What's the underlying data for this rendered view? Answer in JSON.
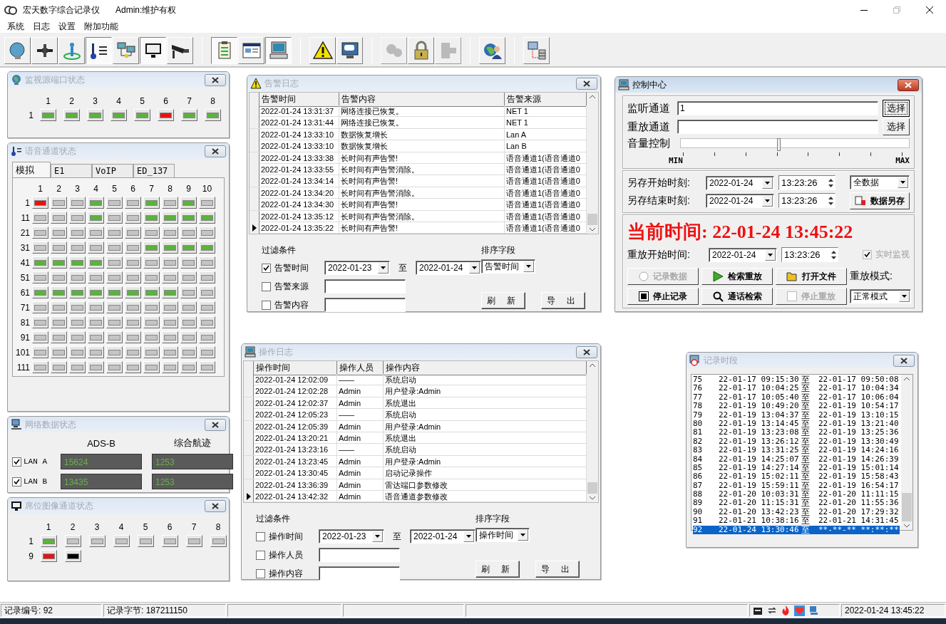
{
  "app": {
    "title": "宏天数字综合记录仪",
    "user": "Admin:维护有权"
  },
  "menu": [
    {
      "label": "系统"
    },
    {
      "label": "日志"
    },
    {
      "label": "设置"
    },
    {
      "label": "附加功能"
    }
  ],
  "toolbar": [
    [
      {
        "pressed": false,
        "disabled": false
      },
      {
        "pressed": false,
        "disabled": false
      },
      {
        "pressed": false,
        "disabled": false
      },
      {
        "pressed": true,
        "disabled": false
      },
      {
        "pressed": false,
        "disabled": false
      },
      {
        "pressed": true,
        "disabled": false
      },
      {
        "pressed": false,
        "disabled": false
      }
    ],
    [
      {
        "pressed": true,
        "disabled": false
      },
      {
        "pressed": false,
        "disabled": false
      },
      {
        "pressed": true,
        "disabled": false
      }
    ],
    [
      {
        "pressed": false,
        "disabled": false
      },
      {
        "pressed": false,
        "disabled": false
      }
    ],
    [
      {
        "pressed": false,
        "disabled": true
      },
      {
        "pressed": false,
        "disabled": false
      },
      {
        "pressed": false,
        "disabled": true
      }
    ],
    [
      {
        "pressed": false,
        "disabled": false
      }
    ],
    [
      {
        "pressed": false,
        "disabled": false
      }
    ]
  ],
  "port_status": {
    "title": "监视源端口状态",
    "active": false,
    "columns": [
      "1",
      "2",
      "3",
      "4",
      "5",
      "6",
      "7",
      "8"
    ],
    "rows": [
      {
        "label": "1",
        "lights": [
          {
            "color": "#5ab33b"
          },
          {
            "color": "#5ab33b"
          },
          {
            "color": "#5ab33b"
          },
          {
            "color": "#5ab33b"
          },
          {
            "color": "#5ab33b"
          },
          {
            "color": "#e31414"
          },
          {
            "color": "#5ab33b"
          },
          {
            "color": "#5ab33b"
          }
        ]
      }
    ]
  },
  "voice_status": {
    "title": "语音通道状态",
    "active": false,
    "tabs": [
      {
        "label": "模拟",
        "selected": true
      },
      {
        "label": "E1",
        "selected": false
      },
      {
        "label": "VoIP",
        "selected": false
      },
      {
        "label": "ED_137",
        "selected": false
      }
    ],
    "columns": [
      "1",
      "2",
      "3",
      "4",
      "5",
      "6",
      "7",
      "8",
      "9",
      "10"
    ],
    "rows": [
      {
        "label": "1",
        "lights": [
          {
            "color": "#e31414"
          },
          {
            "color": "#c4c4c4"
          },
          {
            "color": "#c4c4c4"
          },
          {
            "color": "#5ab33b"
          },
          {
            "color": "#c4c4c4"
          },
          {
            "color": "#c4c4c4"
          },
          {
            "color": "#5ab33b"
          },
          {
            "color": "#c4c4c4"
          },
          {
            "color": "#5ab33b"
          },
          {
            "color": "#c4c4c4"
          }
        ]
      },
      {
        "label": "11",
        "lights": [
          {
            "color": "#c4c4c4"
          },
          {
            "color": "#c4c4c4"
          },
          {
            "color": "#c4c4c4"
          },
          {
            "color": "#5ab33b"
          },
          {
            "color": "#c4c4c4"
          },
          {
            "color": "#c4c4c4"
          },
          {
            "color": "#5ab33b"
          },
          {
            "color": "#5ab33b"
          },
          {
            "color": "#5ab33b"
          },
          {
            "color": "#5ab33b"
          }
        ]
      },
      {
        "label": "21",
        "lights": [
          {
            "color": "#c4c4c4"
          },
          {
            "color": "#c4c4c4"
          },
          {
            "color": "#c4c4c4"
          },
          {
            "color": "#c4c4c4"
          },
          {
            "color": "#c4c4c4"
          },
          {
            "color": "#c4c4c4"
          },
          {
            "color": "#c4c4c4"
          },
          {
            "color": "#c4c4c4"
          },
          {
            "color": "#c4c4c4"
          },
          {
            "color": "#c4c4c4"
          }
        ]
      },
      {
        "label": "31",
        "lights": [
          {
            "color": "#c4c4c4"
          },
          {
            "color": "#c4c4c4"
          },
          {
            "color": "#c4c4c4"
          },
          {
            "color": "#c4c4c4"
          },
          {
            "color": "#c4c4c4"
          },
          {
            "color": "#c4c4c4"
          },
          {
            "color": "#5ab33b"
          },
          {
            "color": "#5ab33b"
          },
          {
            "color": "#5ab33b"
          },
          {
            "color": "#5ab33b"
          }
        ]
      },
      {
        "label": "41",
        "lights": [
          {
            "color": "#5ab33b"
          },
          {
            "color": "#5ab33b"
          },
          {
            "color": "#5ab33b"
          },
          {
            "color": "#5ab33b"
          },
          {
            "color": "#c4c4c4"
          },
          {
            "color": "#c4c4c4"
          },
          {
            "color": "#c4c4c4"
          },
          {
            "color": "#c4c4c4"
          },
          {
            "color": "#c4c4c4"
          },
          {
            "color": "#c4c4c4"
          }
        ]
      },
      {
        "label": "51",
        "lights": [
          {
            "color": "#c4c4c4"
          },
          {
            "color": "#c4c4c4"
          },
          {
            "color": "#c4c4c4"
          },
          {
            "color": "#c4c4c4"
          },
          {
            "color": "#c4c4c4"
          },
          {
            "color": "#c4c4c4"
          },
          {
            "color": "#c4c4c4"
          },
          {
            "color": "#c4c4c4"
          },
          {
            "color": "#c4c4c4"
          },
          {
            "color": "#c4c4c4"
          }
        ]
      },
      {
        "label": "61",
        "lights": [
          {
            "color": "#5ab33b"
          },
          {
            "color": "#5ab33b"
          },
          {
            "color": "#5ab33b"
          },
          {
            "color": "#5ab33b"
          },
          {
            "color": "#5ab33b"
          },
          {
            "color": "#5ab33b"
          },
          {
            "color": "#5ab33b"
          },
          {
            "color": "#5ab33b"
          },
          {
            "color": "#c4c4c4"
          },
          {
            "color": "#c4c4c4"
          }
        ]
      },
      {
        "label": "71",
        "lights": [
          {
            "color": "#c4c4c4"
          },
          {
            "color": "#c4c4c4"
          },
          {
            "color": "#c4c4c4"
          },
          {
            "color": "#c4c4c4"
          },
          {
            "color": "#c4c4c4"
          },
          {
            "color": "#c4c4c4"
          },
          {
            "color": "#c4c4c4"
          },
          {
            "color": "#c4c4c4"
          },
          {
            "color": "#c4c4c4"
          },
          {
            "color": "#c4c4c4"
          }
        ]
      },
      {
        "label": "81",
        "lights": [
          {
            "color": "#c4c4c4"
          },
          {
            "color": "#c4c4c4"
          },
          {
            "color": "#c4c4c4"
          },
          {
            "color": "#c4c4c4"
          },
          {
            "color": "#c4c4c4"
          },
          {
            "color": "#c4c4c4"
          },
          {
            "color": "#c4c4c4"
          },
          {
            "color": "#c4c4c4"
          },
          {
            "color": "#c4c4c4"
          },
          {
            "color": "#c4c4c4"
          }
        ]
      },
      {
        "label": "91",
        "lights": [
          {
            "color": "#c4c4c4"
          },
          {
            "color": "#c4c4c4"
          },
          {
            "color": "#c4c4c4"
          },
          {
            "color": "#c4c4c4"
          },
          {
            "color": "#c4c4c4"
          },
          {
            "color": "#c4c4c4"
          },
          {
            "color": "#c4c4c4"
          },
          {
            "color": "#c4c4c4"
          },
          {
            "color": "#c4c4c4"
          },
          {
            "color": "#c4c4c4"
          }
        ]
      },
      {
        "label": "101",
        "lights": [
          {
            "color": "#c4c4c4"
          },
          {
            "color": "#c4c4c4"
          },
          {
            "color": "#c4c4c4"
          },
          {
            "color": "#c4c4c4"
          },
          {
            "color": "#c4c4c4"
          },
          {
            "color": "#c4c4c4"
          },
          {
            "color": "#c4c4c4"
          },
          {
            "color": "#c4c4c4"
          },
          {
            "color": "#c4c4c4"
          },
          {
            "color": "#c4c4c4"
          }
        ]
      },
      {
        "label": "111",
        "lights": [
          {
            "color": "#c4c4c4"
          },
          {
            "color": "#c4c4c4"
          },
          {
            "color": "#c4c4c4"
          },
          {
            "color": "#c4c4c4"
          },
          {
            "color": "#c4c4c4"
          },
          {
            "color": "#c4c4c4"
          },
          {
            "color": "#c4c4c4"
          },
          {
            "color": "#c4c4c4"
          },
          {
            "color": "#c4c4c4"
          },
          {
            "color": "#c4c4c4"
          }
        ]
      }
    ]
  },
  "network_status": {
    "title": "网络数据状态",
    "active": false,
    "columns": [
      "ADS-B",
      "综合航迹"
    ],
    "rows": [
      {
        "label": "LAN A",
        "checked": true,
        "values": [
          "15624",
          "1253"
        ]
      },
      {
        "label": "LAN B",
        "checked": true,
        "values": [
          "13435",
          "1253"
        ]
      }
    ]
  },
  "seat_status": {
    "title": "席位图像通道状态",
    "active": false,
    "columns": [
      "1",
      "2",
      "3",
      "4",
      "5",
      "6",
      "7",
      "8"
    ],
    "rows": [
      {
        "label": "1",
        "lights": [
          {
            "color": "#5ab33b"
          },
          {
            "color": "#c4c4c4"
          },
          {
            "color": "#c4c4c4"
          },
          {
            "color": "#c4c4c4"
          },
          {
            "color": "#c4c4c4"
          },
          {
            "color": "#c4c4c4"
          },
          {
            "color": "#c4c4c4"
          },
          {
            "color": "#c4c4c4"
          }
        ]
      },
      {
        "label": "9",
        "lights": [
          {
            "color": "#e31414"
          },
          {
            "color": "#000000"
          }
        ]
      }
    ]
  },
  "alarm_log": {
    "title": "告警日志",
    "active": false,
    "columns": [
      "告警时间",
      "告警内容",
      "告警来源"
    ],
    "rows": [
      {
        "cells": [
          "2022-01-24 13:31:37",
          "网络连接已恢复。",
          "NET 1"
        ],
        "current": false
      },
      {
        "cells": [
          "2022-01-24 13:31:44",
          "网络连接已恢复。",
          "NET 1"
        ],
        "current": false
      },
      {
        "cells": [
          "2022-01-24 13:33:10",
          "数据恢复增长",
          "Lan A"
        ],
        "current": false
      },
      {
        "cells": [
          "2022-01-24 13:33:10",
          "数据恢复增长",
          "Lan B"
        ],
        "current": false
      },
      {
        "cells": [
          "2022-01-24 13:33:38",
          "长时间有声告警!",
          "语音通道1(语音通道0"
        ],
        "current": false
      },
      {
        "cells": [
          "2022-01-24 13:33:55",
          "长时间有声告警消除。",
          "语音通道1(语音通道0"
        ],
        "current": false
      },
      {
        "cells": [
          "2022-01-24 13:34:14",
          "长时间有声告警!",
          "语音通道1(语音通道0"
        ],
        "current": false
      },
      {
        "cells": [
          "2022-01-24 13:34:20",
          "长时间有声告警消除。",
          "语音通道1(语音通道0"
        ],
        "current": false
      },
      {
        "cells": [
          "2022-01-24 13:34:30",
          "长时间有声告警!",
          "语音通道1(语音通道0"
        ],
        "current": false
      },
      {
        "cells": [
          "2022-01-24 13:35:12",
          "长时间有声告警消除。",
          "语音通道1(语音通道0"
        ],
        "current": false
      },
      {
        "cells": [
          "2022-01-24 13:35:22",
          "长时间有声告警!",
          "语音通道1(语音通道0"
        ],
        "current": true
      }
    ],
    "filter": {
      "label": "过滤条件",
      "items": [
        {
          "kind": "date-range",
          "label": "告警时间",
          "checked": true,
          "from": "2022-01-23",
          "separator": "至",
          "to": "2022-01-24"
        },
        {
          "kind": "text",
          "label": "告警来源",
          "checked": false
        },
        {
          "kind": "text",
          "label": "告警内容",
          "checked": false
        }
      ]
    },
    "sort": {
      "label": "排序字段",
      "value": "告警时间"
    },
    "buttons": [
      "刷 新",
      "导 出"
    ]
  },
  "control_center": {
    "title": "控制中心",
    "active": true,
    "listen": {
      "label": "监听通道",
      "value": "1",
      "button": "选择",
      "focused": true
    },
    "replay": {
      "label": "重放通道",
      "button": "选择",
      "focused": false
    },
    "volume": {
      "label": "音量控制",
      "level": 0.43,
      "min": "MIN",
      "max": "MAX"
    },
    "save_start": {
      "label": "另存开始时刻:",
      "date": "2022-01-24",
      "time": "13:23:26"
    },
    "save_end": {
      "label": "另存结束时刻:",
      "date": "2022-01-24",
      "time": "13:23:26"
    },
    "save_type": "全数据",
    "save_button": "数据另存",
    "current_time": "当前时间: 22-01-24 13:45:22",
    "replay_start": {
      "label": "重放开始时间:",
      "date": "2022-01-24",
      "time": "13:23:26"
    },
    "realtime": {
      "label": "实时监视",
      "checked": true,
      "disabled": true
    },
    "actions": [
      {
        "kind": "radio",
        "label": "记录数据",
        "disabled": true
      },
      {
        "kind": "play",
        "label": "检索重放",
        "disabled": false
      },
      {
        "kind": "folder",
        "label": "打开文件",
        "disabled": false
      },
      {
        "kind": "stop",
        "label": "停止记录",
        "disabled": false
      },
      {
        "kind": "search",
        "label": "通话检索",
        "disabled": false
      },
      {
        "kind": "check",
        "label": "停止重放",
        "disabled": true
      }
    ],
    "mode": {
      "label": "重放模式:",
      "value": "正常模式"
    }
  },
  "operation_log": {
    "title": "操作日志",
    "active": false,
    "columns": [
      "操作时间",
      "操作人员",
      "操作内容"
    ],
    "rows": [
      {
        "cells": [
          "2022-01-24 12:02:09",
          "——",
          "系统启动"
        ],
        "current": false
      },
      {
        "cells": [
          "2022-01-24 12:02:28",
          "Admin",
          "用户登录:Admin"
        ],
        "current": false
      },
      {
        "cells": [
          "2022-01-24 12:02:37",
          "Admin",
          "系统退出"
        ],
        "current": false
      },
      {
        "cells": [
          "2022-01-24 12:05:23",
          "——",
          "系统启动"
        ],
        "current": false
      },
      {
        "cells": [
          "2022-01-24 12:05:39",
          "Admin",
          "用户登录:Admin"
        ],
        "current": false
      },
      {
        "cells": [
          "2022-01-24 13:20:21",
          "Admin",
          "系统退出"
        ],
        "current": false
      },
      {
        "cells": [
          "2022-01-24 13:23:16",
          "——",
          "系统启动"
        ],
        "current": false
      },
      {
        "cells": [
          "2022-01-24 13:23:45",
          "Admin",
          "用户登录:Admin"
        ],
        "current": false
      },
      {
        "cells": [
          "2022-01-24 13:30:45",
          "Admin",
          "启动记录操作"
        ],
        "current": false
      },
      {
        "cells": [
          "2022-01-24 13:36:39",
          "Admin",
          "雷达端口参数修改"
        ],
        "current": false
      },
      {
        "cells": [
          "2022-01-24 13:42:32",
          "Admin",
          "语音通道参数修改"
        ],
        "current": true
      }
    ],
    "filter": {
      "label": "过滤条件",
      "items": [
        {
          "kind": "date-range",
          "label": "操作时间",
          "checked": false,
          "from": "2022-01-23",
          "separator": "至",
          "to": "2022-01-24"
        },
        {
          "kind": "text",
          "label": "操作人员",
          "checked": false
        },
        {
          "kind": "text",
          "label": "操作内容",
          "checked": false
        }
      ]
    },
    "sort": {
      "label": "排序字段",
      "value": "操作时间"
    },
    "buttons": [
      "刷 新",
      "导 出"
    ]
  },
  "record_periods": {
    "title": "记录时段",
    "active": false,
    "rows": [
      {
        "no": "75",
        "start": "22-01-17 09:15:30",
        "separator": "至",
        "end": "22-01-17 09:50:08",
        "selected": false
      },
      {
        "no": "76",
        "start": "22-01-17 10:04:25",
        "separator": "至",
        "end": "22-01-17 10:04:34",
        "selected": false
      },
      {
        "no": "77",
        "start": "22-01-17 10:05:40",
        "separator": "至",
        "end": "22-01-17 10:06:04",
        "selected": false
      },
      {
        "no": "78",
        "start": "22-01-19 10:49:20",
        "separator": "至",
        "end": "22-01-19 10:54:17",
        "selected": false
      },
      {
        "no": "79",
        "start": "22-01-19 13:04:37",
        "separator": "至",
        "end": "22-01-19 13:10:15",
        "selected": false
      },
      {
        "no": "80",
        "start": "22-01-19 13:14:45",
        "separator": "至",
        "end": "22-01-19 13:21:40",
        "selected": false
      },
      {
        "no": "81",
        "start": "22-01-19 13:23:08",
        "separator": "至",
        "end": "22-01-19 13:25:36",
        "selected": false
      },
      {
        "no": "82",
        "start": "22-01-19 13:26:12",
        "separator": "至",
        "end": "22-01-19 13:30:49",
        "selected": false
      },
      {
        "no": "83",
        "start": "22-01-19 13:31:25",
        "separator": "至",
        "end": "22-01-19 14:24:16",
        "selected": false
      },
      {
        "no": "84",
        "start": "22-01-19 14:25:07",
        "separator": "至",
        "end": "22-01-19 14:26:39",
        "selected": false
      },
      {
        "no": "85",
        "start": "22-01-19 14:27:14",
        "separator": "至",
        "end": "22-01-19 15:01:14",
        "selected": false
      },
      {
        "no": "86",
        "start": "22-01-19 15:02:11",
        "separator": "至",
        "end": "22-01-19 15:58:43",
        "selected": false
      },
      {
        "no": "87",
        "start": "22-01-19 15:59:11",
        "separator": "至",
        "end": "22-01-19 16:54:17",
        "selected": false
      },
      {
        "no": "88",
        "start": "22-01-20 10:03:31",
        "separator": "至",
        "end": "22-01-20 11:11:15",
        "selected": false
      },
      {
        "no": "89",
        "start": "22-01-20 11:15:31",
        "separator": "至",
        "end": "22-01-20 11:55:36",
        "selected": false
      },
      {
        "no": "90",
        "start": "22-01-20 13:42:23",
        "separator": "至",
        "end": "22-01-20 17:29:32",
        "selected": false
      },
      {
        "no": "91",
        "start": "22-01-21 10:38:16",
        "separator": "至",
        "end": "22-01-21 14:31:45",
        "selected": false
      },
      {
        "no": "92",
        "start": "22-01-24 13:30:46",
        "separator": "至",
        "end": "**-**-** **:**:**",
        "selected": true
      }
    ]
  },
  "status_bar": {
    "record_no": "记录编号: 92",
    "record_bytes": "记录字节: 187211150",
    "time": "2022-01-24 13:45:22"
  }
}
